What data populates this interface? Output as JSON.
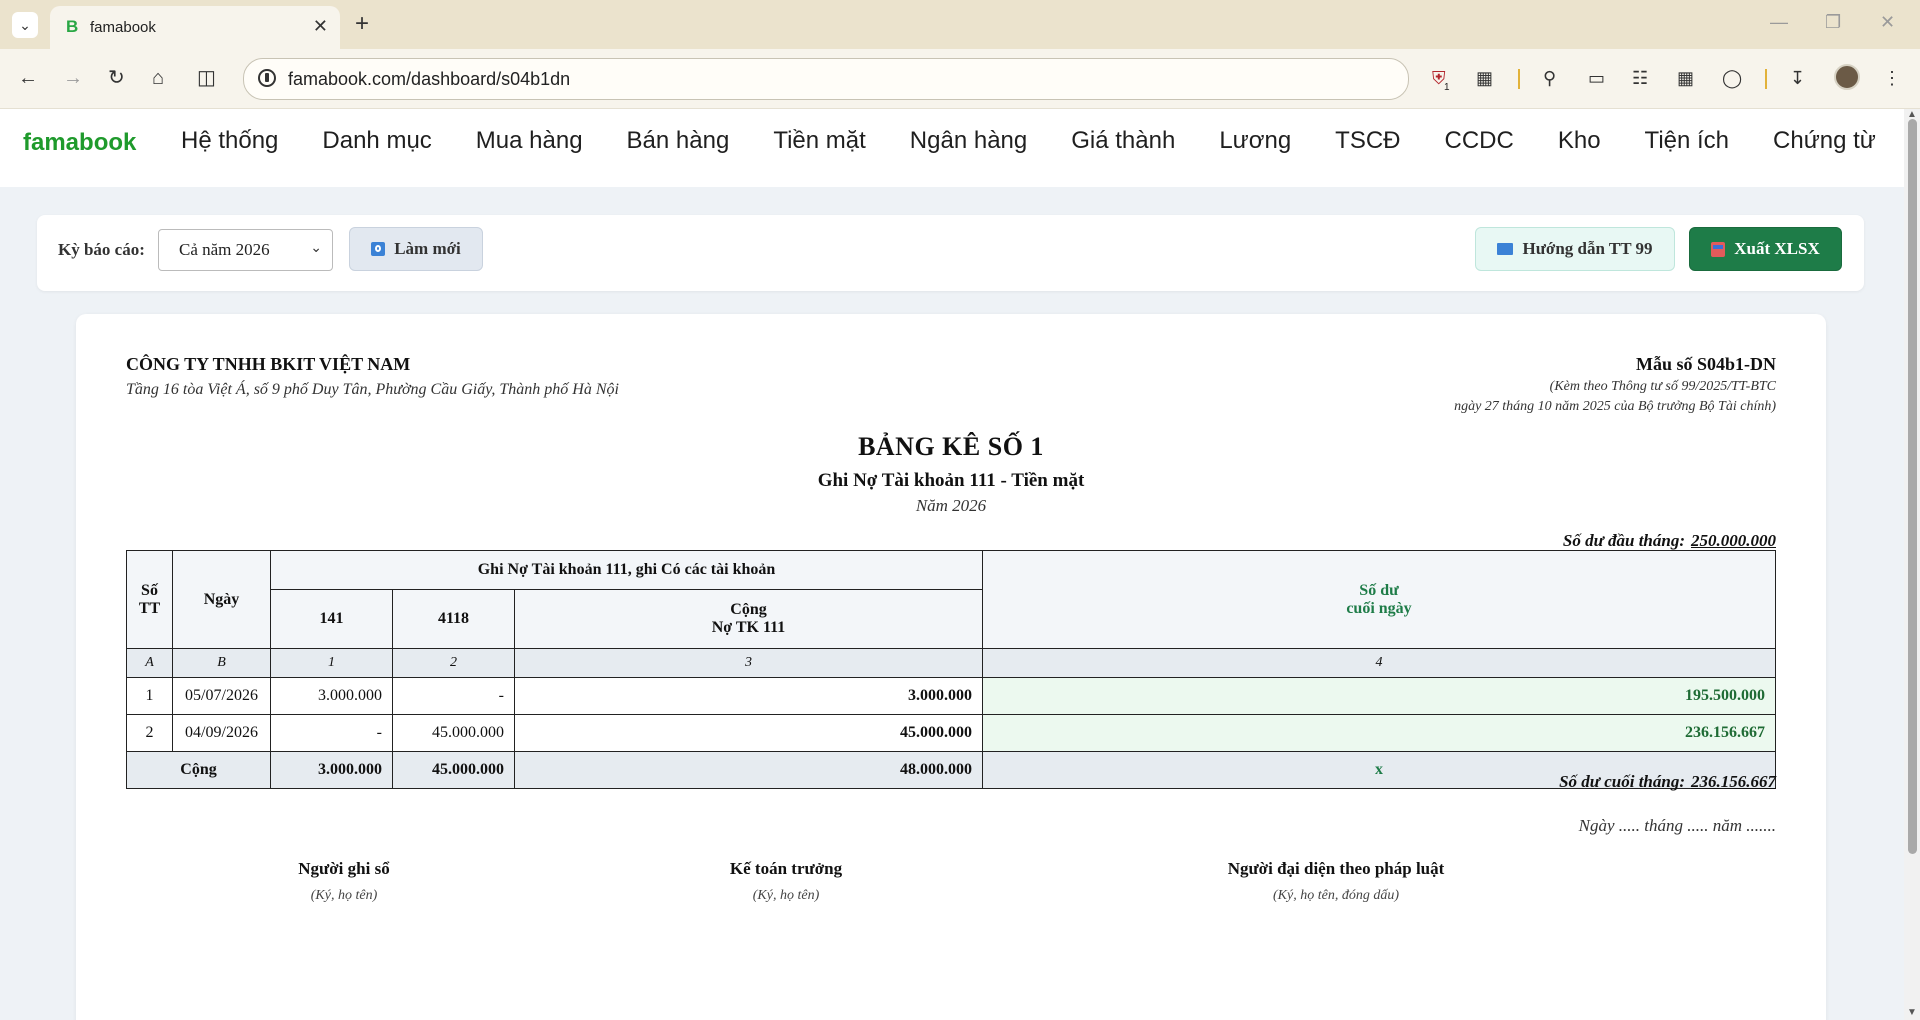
{
  "browser": {
    "tab_title": "famabook",
    "tab_favicon": "B",
    "url": "famabook.com/dashboard/s04b1dn",
    "extension_badge": "1"
  },
  "app": {
    "brand": "famabook",
    "menu": [
      "Hệ thống",
      "Danh mục",
      "Mua hàng",
      "Bán hàng",
      "Tiền mặt",
      "Ngân hàng",
      "Giá thành",
      "Lương",
      "TSCĐ",
      "CCDC",
      "Kho",
      "Tiện ích",
      "Chứng từ"
    ]
  },
  "filter": {
    "label": "Kỳ báo cáo:",
    "period_value": "Cả năm 2026",
    "refresh_label": "Làm mới",
    "guide_label": "Hướng dẫn TT 99",
    "export_label": "Xuất XLSX"
  },
  "report": {
    "company_name": "CÔNG TY TNHH BKIT VIỆT NAM",
    "company_address": "Tầng 16 tòa Việt Á, số 9 phố Duy Tân, Phường Cầu Giấy, Thành phố Hà Nội",
    "form_no": "Mẫu số S04b1-DN",
    "form_ref_1": "(Kèm theo Thông tư số 99/2025/TT-BTC",
    "form_ref_2": "ngày 27 tháng 10 năm 2025 của Bộ trưởng Bộ Tài chính)",
    "title": "BẢNG KÊ SỐ 1",
    "subtitle": "Ghi Nợ Tài khoản 111 - Tiền mặt",
    "year": "Năm 2026",
    "opening_label": "Số dư đầu tháng:",
    "opening_value": "250.000.000",
    "closing_label": "Số dư cuối tháng:",
    "closing_value": "236.156.667",
    "date_line": "Ngày ..... tháng ..... năm .......",
    "table": {
      "h_stt_1": "Số",
      "h_stt_2": "TT",
      "h_date": "Ngày",
      "h_group": "Ghi Nợ Tài khoản 111, ghi Có các tài khoản",
      "h_141": "141",
      "h_4118": "4118",
      "h_total_1": "Cộng",
      "h_total_2": "Nợ TK 111",
      "h_bal_1": "Số dư",
      "h_bal_2": "cuối ngày",
      "idx": [
        "A",
        "B",
        "1",
        "2",
        "3",
        "4"
      ],
      "rows": [
        {
          "stt": "1",
          "date": "05/07/2026",
          "a141": "3.000.000",
          "a4118": "-",
          "total": "3.000.000",
          "balance": "195.500.000"
        },
        {
          "stt": "2",
          "date": "04/09/2026",
          "a141": "-",
          "a4118": "45.000.000",
          "total": "45.000.000",
          "balance": "236.156.667"
        }
      ],
      "total_label": "Cộng",
      "total_141": "3.000.000",
      "total_4118": "45.000.000",
      "total_sum": "48.000.000",
      "total_balance": "x"
    },
    "signers": [
      {
        "title": "Người ghi sổ",
        "note": "(Ký, họ tên)"
      },
      {
        "title": "Kế toán trưởng",
        "note": "(Ký, họ tên)"
      },
      {
        "title": "Người đại diện theo pháp luật",
        "note": "(Ký, họ tên, đóng dấu)"
      }
    ]
  }
}
